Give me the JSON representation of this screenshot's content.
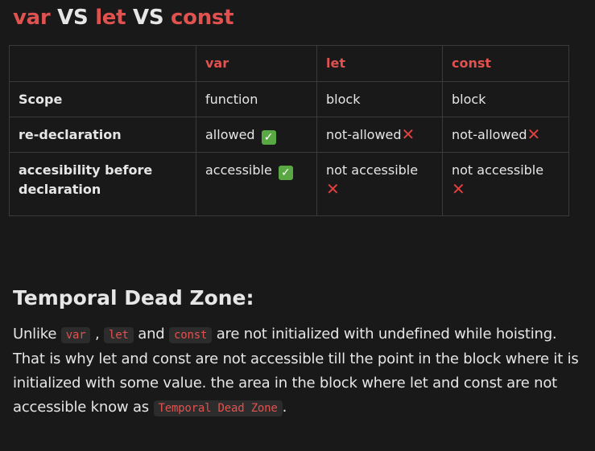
{
  "title": {
    "kw_var": "var",
    "vs1": " VS ",
    "kw_let": "let",
    "vs2": " VS ",
    "kw_const": "const"
  },
  "table": {
    "headers": [
      "",
      "var",
      "let",
      "const"
    ],
    "rows": [
      {
        "label": "Scope",
        "cells": [
          "function",
          "block",
          "block"
        ]
      },
      {
        "label": "re-declaration",
        "cells": [
          "allowed",
          "not-allowed",
          "not-allowed"
        ]
      },
      {
        "label": "accesibility before declaration",
        "cells": [
          "accessible",
          "not accessible",
          "not accessible"
        ]
      }
    ],
    "check_symbol": "✓",
    "cross_symbol": "✕"
  },
  "section": {
    "heading": "Temporal Dead Zone:",
    "p_before": "Unlike ",
    "code_var": "var",
    "p_sep1": " , ",
    "code_let": "let",
    "p_and": " and ",
    "code_const": "const",
    "p_middle": " are not initialized with undefined while hoisting. That is why let and const are not accessible till the point in the block where it is initialized with some value. the area in the block where let and const are not accessible know as ",
    "code_tdz": "Temporal Dead Zone",
    "p_end": "."
  },
  "colors": {
    "background": "#191919",
    "keyword": "#e0524f",
    "check": "#5aa844",
    "cross": "#e0403f",
    "border": "#3a3a3a"
  }
}
